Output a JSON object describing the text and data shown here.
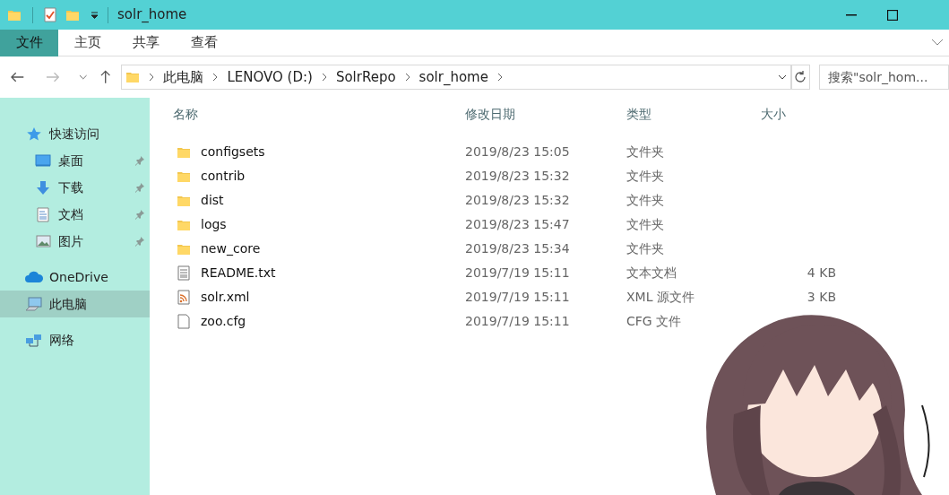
{
  "window": {
    "title": "solr_home"
  },
  "ribbon_tabs": [
    {
      "label": "文件",
      "selected": true
    },
    {
      "label": "主页",
      "selected": false
    },
    {
      "label": "共享",
      "selected": false
    },
    {
      "label": "查看",
      "selected": false
    }
  ],
  "address": {
    "crumbs": [
      "此电脑",
      "LENOVO (D:)",
      "SolrRepo",
      "solr_home"
    ]
  },
  "search": {
    "placeholder": "搜索\"solr_hom..."
  },
  "sidebar": {
    "items": [
      {
        "label": "快速访问",
        "kind": "star",
        "pinned": false,
        "selected": false,
        "indent": false
      },
      {
        "label": "桌面",
        "kind": "desktop",
        "pinned": true,
        "selected": false,
        "indent": true
      },
      {
        "label": "下载",
        "kind": "download",
        "pinned": true,
        "selected": false,
        "indent": true
      },
      {
        "label": "文档",
        "kind": "document",
        "pinned": true,
        "selected": false,
        "indent": true
      },
      {
        "label": "图片",
        "kind": "pictures",
        "pinned": true,
        "selected": false,
        "indent": true
      },
      {
        "label": "OneDrive",
        "kind": "cloud",
        "pinned": false,
        "selected": false,
        "indent": false
      },
      {
        "label": "此电脑",
        "kind": "computer",
        "pinned": false,
        "selected": true,
        "indent": false
      },
      {
        "label": "网络",
        "kind": "network",
        "pinned": false,
        "selected": false,
        "indent": false
      }
    ]
  },
  "table": {
    "columns": [
      "名称",
      "修改日期",
      "类型",
      "大小"
    ],
    "rows": [
      {
        "kind": "folder",
        "name": "configsets",
        "date": "2019/8/23 15:05",
        "type": "文件夹"
      },
      {
        "kind": "folder",
        "name": "contrib",
        "date": "2019/8/23 15:32",
        "type": "文件夹"
      },
      {
        "kind": "folder",
        "name": "dist",
        "date": "2019/8/23 15:32",
        "type": "文件夹"
      },
      {
        "kind": "folder",
        "name": "logs",
        "date": "2019/8/23 15:47",
        "type": "文件夹"
      },
      {
        "kind": "folder",
        "name": "new_core",
        "date": "2019/8/23 15:34",
        "type": "文件夹"
      },
      {
        "kind": "text",
        "name": "README.txt",
        "date": "2019/7/19 15:11",
        "type": "文本文档",
        "size": "4 KB"
      },
      {
        "kind": "xml",
        "name": "solr.xml",
        "date": "2019/7/19 15:11",
        "type": "XML 源文件",
        "size": "3 KB"
      },
      {
        "kind": "file",
        "name": "zoo.cfg",
        "date": "2019/7/19 15:11",
        "type": "CFG 文件"
      }
    ]
  }
}
